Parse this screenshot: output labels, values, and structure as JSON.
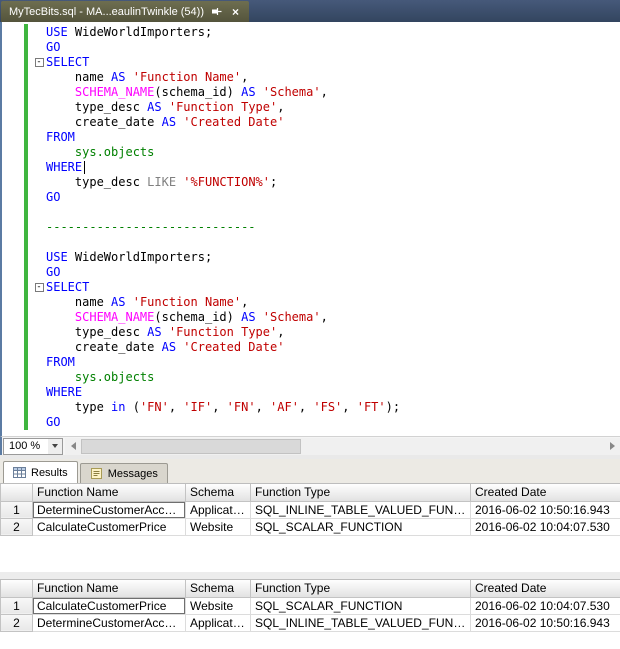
{
  "window": {
    "tab_title": "MyTecBits.sql - MA...eaulinTwinkle (54))",
    "close_label": "×"
  },
  "editor": {
    "lines": [
      {
        "tokens": [
          [
            "kw",
            "USE"
          ],
          [
            "pl",
            " WideWorldImporters;"
          ]
        ]
      },
      {
        "tokens": [
          [
            "kw",
            "GO"
          ]
        ]
      },
      {
        "fold": true,
        "tokens": [
          [
            "kw",
            "SELECT"
          ]
        ]
      },
      {
        "tokens": [
          [
            "pl",
            "    name "
          ],
          [
            "kw",
            "AS"
          ],
          [
            "pl",
            " "
          ],
          [
            "str",
            "'Function Name'"
          ],
          [
            "pl",
            ","
          ]
        ]
      },
      {
        "tokens": [
          [
            "pl",
            "    "
          ],
          [
            "fn",
            "SCHEMA_NAME"
          ],
          [
            "pl",
            "(schema_id) "
          ],
          [
            "kw",
            "AS"
          ],
          [
            "pl",
            " "
          ],
          [
            "str",
            "'Schema'"
          ],
          [
            "pl",
            ","
          ]
        ]
      },
      {
        "tokens": [
          [
            "pl",
            "    type_desc "
          ],
          [
            "kw",
            "AS"
          ],
          [
            "pl",
            " "
          ],
          [
            "str",
            "'Function Type'"
          ],
          [
            "pl",
            ","
          ]
        ]
      },
      {
        "tokens": [
          [
            "pl",
            "    create_date "
          ],
          [
            "kw",
            "AS"
          ],
          [
            "pl",
            " "
          ],
          [
            "str",
            "'Created Date'"
          ]
        ]
      },
      {
        "tokens": [
          [
            "kw",
            "FROM"
          ]
        ]
      },
      {
        "tokens": [
          [
            "pl",
            "    "
          ],
          [
            "obj",
            "sys.objects"
          ]
        ]
      },
      {
        "tokens": [
          [
            "kw",
            "WHERE"
          ]
        ],
        "caret": true
      },
      {
        "tokens": [
          [
            "pl",
            "    type_desc "
          ],
          [
            "op",
            "LIKE"
          ],
          [
            "pl",
            " "
          ],
          [
            "str",
            "'%FUNCTION%'"
          ],
          [
            "pl",
            ";"
          ]
        ]
      },
      {
        "tokens": [
          [
            "kw",
            "GO"
          ]
        ]
      },
      {
        "tokens": []
      },
      {
        "tokens": [
          [
            "cmt",
            "-----------------------------"
          ]
        ]
      },
      {
        "tokens": []
      },
      {
        "tokens": [
          [
            "kw",
            "USE"
          ],
          [
            "pl",
            " WideWorldImporters;"
          ]
        ]
      },
      {
        "tokens": [
          [
            "kw",
            "GO"
          ]
        ]
      },
      {
        "fold": true,
        "tokens": [
          [
            "kw",
            "SELECT"
          ]
        ]
      },
      {
        "tokens": [
          [
            "pl",
            "    name "
          ],
          [
            "kw",
            "AS"
          ],
          [
            "pl",
            " "
          ],
          [
            "str",
            "'Function Name'"
          ],
          [
            "pl",
            ","
          ]
        ]
      },
      {
        "tokens": [
          [
            "pl",
            "    "
          ],
          [
            "fn",
            "SCHEMA_NAME"
          ],
          [
            "pl",
            "(schema_id) "
          ],
          [
            "kw",
            "AS"
          ],
          [
            "pl",
            " "
          ],
          [
            "str",
            "'Schema'"
          ],
          [
            "pl",
            ","
          ]
        ]
      },
      {
        "tokens": [
          [
            "pl",
            "    type_desc "
          ],
          [
            "kw",
            "AS"
          ],
          [
            "pl",
            " "
          ],
          [
            "str",
            "'Function Type'"
          ],
          [
            "pl",
            ","
          ]
        ]
      },
      {
        "tokens": [
          [
            "pl",
            "    create_date "
          ],
          [
            "kw",
            "AS"
          ],
          [
            "pl",
            " "
          ],
          [
            "str",
            "'Created Date'"
          ]
        ]
      },
      {
        "tokens": [
          [
            "kw",
            "FROM"
          ]
        ]
      },
      {
        "tokens": [
          [
            "pl",
            "    "
          ],
          [
            "obj",
            "sys.objects"
          ]
        ]
      },
      {
        "tokens": [
          [
            "kw",
            "WHERE"
          ]
        ]
      },
      {
        "tokens": [
          [
            "pl",
            "    type "
          ],
          [
            "kw",
            "in"
          ],
          [
            "pl",
            " ("
          ],
          [
            "str",
            "'FN'"
          ],
          [
            "pl",
            ", "
          ],
          [
            "str",
            "'IF'"
          ],
          [
            "pl",
            ", "
          ],
          [
            "str",
            "'FN'"
          ],
          [
            "pl",
            ", "
          ],
          [
            "str",
            "'AF'"
          ],
          [
            "pl",
            ", "
          ],
          [
            "str",
            "'FS'"
          ],
          [
            "pl",
            ", "
          ],
          [
            "str",
            "'FT'"
          ],
          [
            "pl",
            ");"
          ]
        ]
      },
      {
        "tokens": [
          [
            "kw",
            "GO"
          ]
        ]
      }
    ]
  },
  "statusbar": {
    "zoom_level": "100 %"
  },
  "results_pane": {
    "tabs": [
      {
        "label": "Results"
      },
      {
        "label": "Messages"
      }
    ]
  },
  "grids": [
    {
      "columns": [
        "Function Name",
        "Schema",
        "Function Type",
        "Created Date"
      ],
      "rows": [
        {
          "num": "1",
          "cells": [
            "DetermineCustomerAccess",
            "Application",
            "SQL_INLINE_TABLE_VALUED_FUNCTION",
            "2016-06-02 10:50:16.943"
          ]
        },
        {
          "num": "2",
          "cells": [
            "CalculateCustomerPrice",
            "Website",
            "SQL_SCALAR_FUNCTION",
            "2016-06-02 10:04:07.530"
          ]
        }
      ],
      "focused_cell": [
        0,
        0
      ]
    },
    {
      "columns": [
        "Function Name",
        "Schema",
        "Function Type",
        "Created Date"
      ],
      "rows": [
        {
          "num": "1",
          "cells": [
            "CalculateCustomerPrice",
            "Website",
            "SQL_SCALAR_FUNCTION",
            "2016-06-02 10:04:07.530"
          ]
        },
        {
          "num": "2",
          "cells": [
            "DetermineCustomerAccess",
            "Application",
            "SQL_INLINE_TABLE_VALUED_FUNCTION",
            "2016-06-02 10:50:16.943"
          ]
        }
      ],
      "focused_cell": [
        0,
        0
      ]
    }
  ],
  "colors": {
    "keyword": "#0000ff",
    "string": "#c00000",
    "system_function": "#ff00ff",
    "system_object": "#008000",
    "comment": "#008000",
    "operator": "#808080",
    "change_bar": "#3fb53f"
  }
}
